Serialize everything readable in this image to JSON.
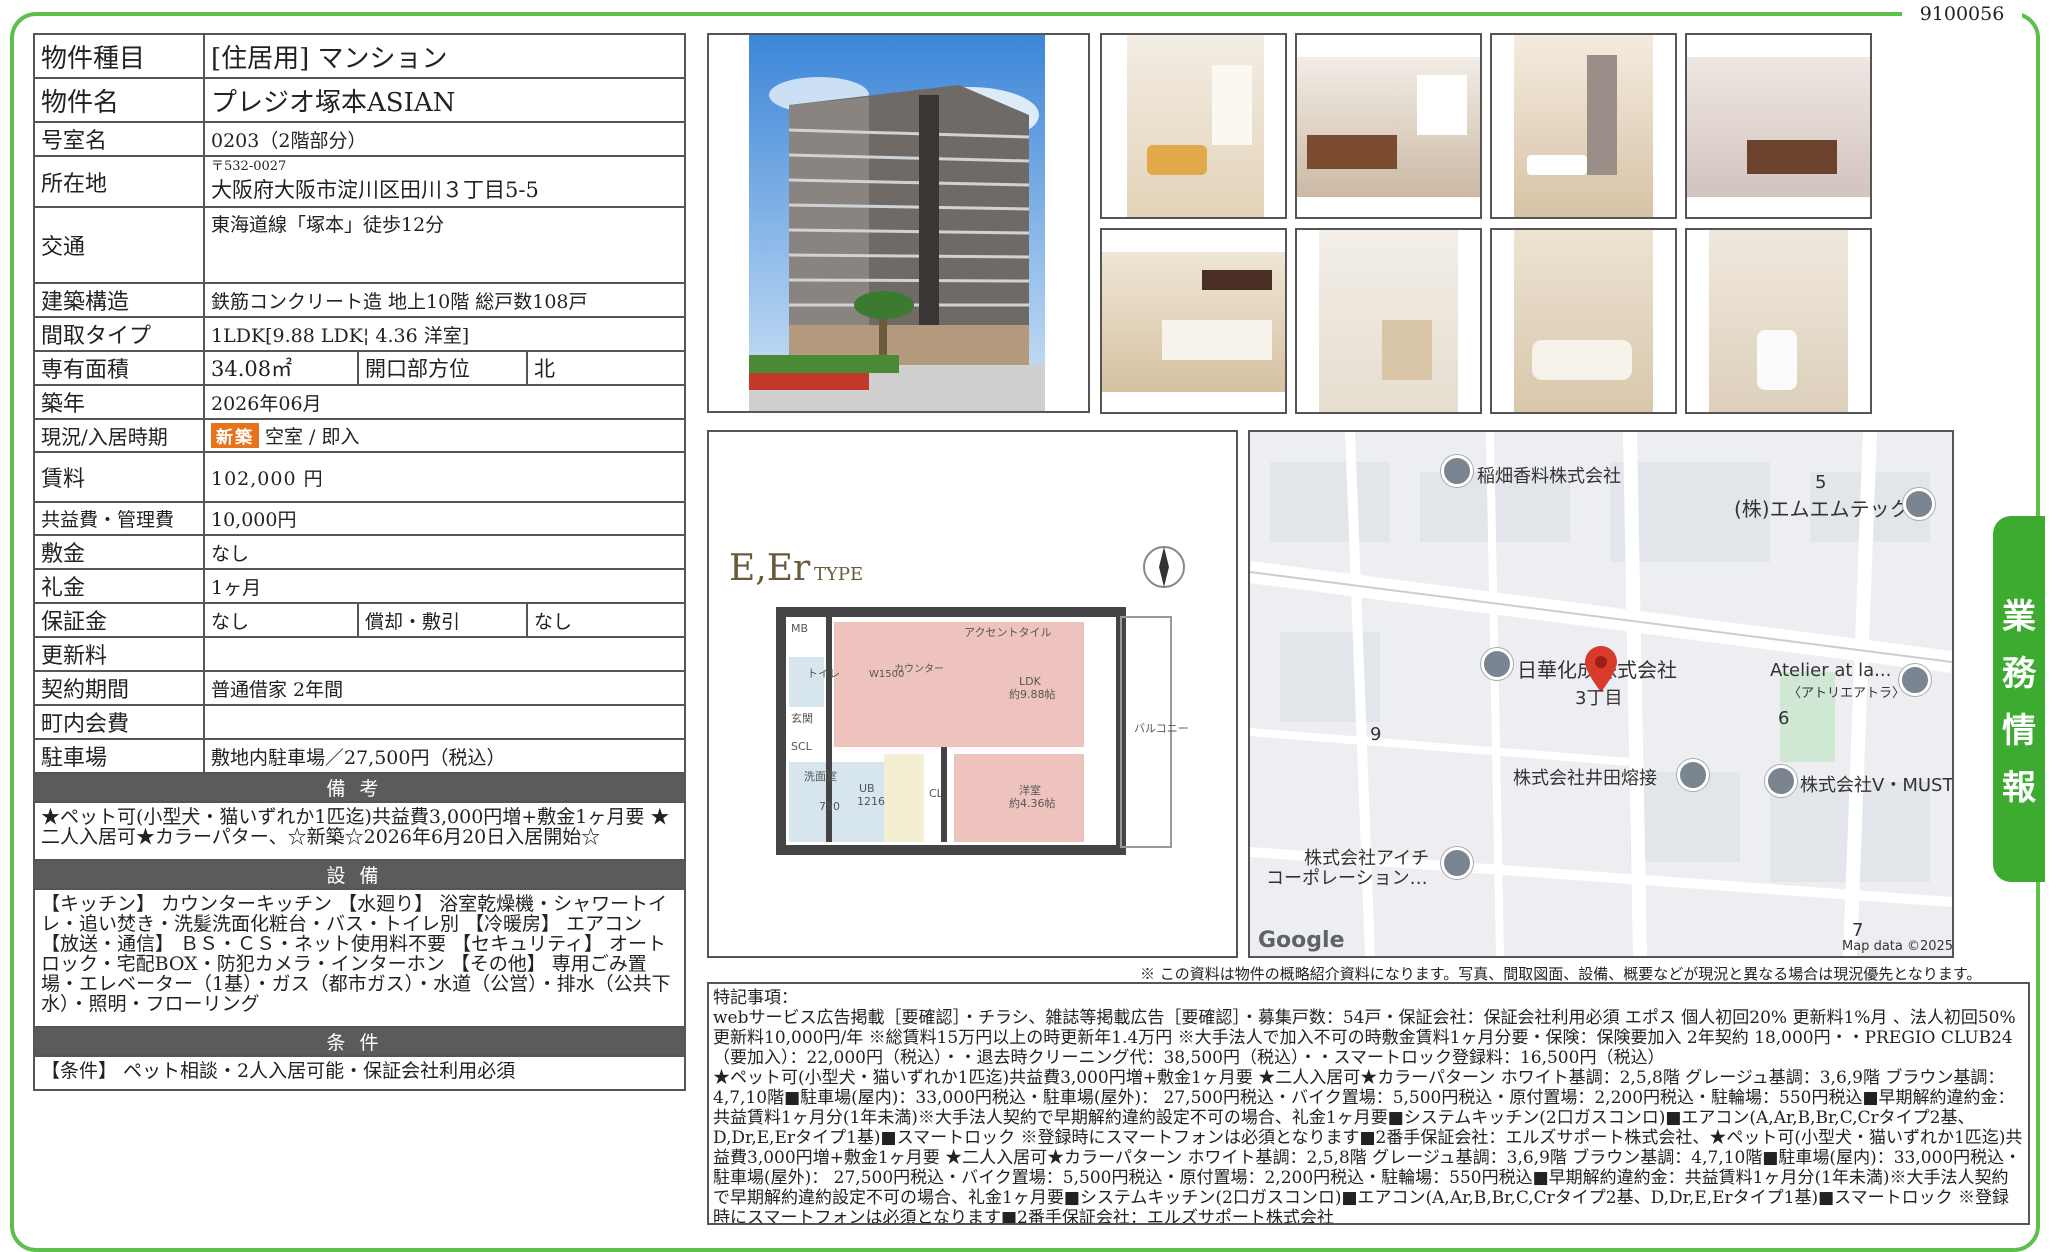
{
  "doc_id": "9100056",
  "side_tab": [
    "業",
    "務",
    "情",
    "報"
  ],
  "property": {
    "type_label": "物件種目",
    "type_value": "[住居用] マンション",
    "name_label": "物件名",
    "name_value": "プレジオ塚本ASIAN",
    "room_label": "号室名",
    "room_value": "0203（2階部分）",
    "address_label": "所在地",
    "zip": "〒532-0027",
    "address": "大阪府大阪市淀川区田川３丁目5-5",
    "access_label": "交通",
    "access_value": "東海道線「塚本」徒歩12分",
    "structure_label": "建築構造",
    "structure_value": "鉄筋コンクリート造 地上10階 総戸数108戸",
    "layout_label": "間取タイプ",
    "layout_value": "1LDK[9.88 LDK¦ 4.36 洋室]",
    "area_label": "専有面積",
    "area_value": "34.08㎡",
    "direction_label": "開口部方位",
    "direction_value": "北",
    "built_label": "築年",
    "built_value": "2026年06月",
    "status_label": "現況/入居時期",
    "status_badge": "新築",
    "status_value": "空室 / 即入",
    "rent_label": "賃料",
    "rent_value": "102,000 円",
    "fee_label": "共益費・管理費",
    "fee_value": "10,000円",
    "deposit_label": "敷金",
    "deposit_value": "なし",
    "keymoney_label": "礼金",
    "keymoney_value": "1ヶ月",
    "guarantee_label": "保証金",
    "guarantee_value": "なし",
    "amort_label": "償却・敷引",
    "amort_value": "なし",
    "renewal_label": "更新料",
    "renewal_value": "",
    "contract_label": "契約期間",
    "contract_value": "普通借家 2年間",
    "community_label": "町内会費",
    "community_value": "",
    "parking_label": "駐車場",
    "parking_value": "敷地内駐車場／27,500円（税込）"
  },
  "remarks": {
    "title": "備考",
    "text": "★ペット可(小型犬・猫いずれか1匹迄)共益費3,000円増+敷金1ヶ月要 ★二人入居可★カラーパター、☆新築☆2026年6月20日入居開始☆"
  },
  "equipment": {
    "title": "設備",
    "text": "【キッチン】 カウンターキッチン 【水廻り】 浴室乾燥機・シャワートイレ・追い焚き・洗髪洗面化粧台・バス・トイレ別 【冷暖房】 エアコン 【放送・通信】 ＢＳ・ＣＳ・ネット使用料不要 【セキュリティ】 オートロック・宅配BOX・防犯カメラ・インターホン 【その他】 専用ごみ置場・エレベーター（1基）・ガス（都市ガス）・水道（公営）・排水（公共下水）・照明・フローリング"
  },
  "conditions": {
    "title": "条件",
    "text": "【条件】 ペット相談・2人入居可能・保証会社利用必須"
  },
  "floorplan": {
    "type_label": "E,Er",
    "type_suffix": "TYPE",
    "rooms": [
      "アクセントタイル",
      "LDK",
      "約9.88帖",
      "洋室",
      "約4.36帖",
      "バルコニー",
      "MB",
      "トイレ",
      "玄関",
      "SCL",
      "洗面室",
      "UB",
      "1216",
      "750",
      "CL",
      "W1500",
      "カウンター"
    ]
  },
  "map": {
    "labels": [
      "稲畑香料株式会社",
      "(株)エムエムテック",
      "日華化成株式会社",
      "3丁目",
      "Atelier at la...",
      "〈アトリエアトラ〉",
      "株式会社井田熔接",
      "株式会社V・MUST",
      "株式会社アイチ",
      "コーポレーション…"
    ],
    "numbers": [
      "5",
      "6",
      "9",
      "7"
    ],
    "google": "Google",
    "credit": "Map data ©2025"
  },
  "disclaimer": "※ この資料は物件の概略紹介資料になります。写真、間取図面、設備、概要などが現況と異なる場合は現況優先となります。",
  "special_notes": {
    "title": "特記事項：",
    "lines": [
      "webサービス広告掲載［要確認］・チラシ、雑誌等掲載広告［要確認］・募集戸数：54戸・保証会社：保証会社利用必須 エポス 個人初回20% 更新料1%月 、法人初回50% 更新料10,000円/年 ※総賃料15万円以上の時更新年1.4万円 ※大手法人で加入不可の時敷金賃料1ヶ月分要・保険：保険要加入 2年契約 18,000円・・PREGIO CLUB24（要加入）：22,000円（税込）・・退去時クリーニング代：38,500円（税込）・・スマートロック登録料：16,500円（税込）",
      "★ペット可(小型犬・猫いずれか1匹迄)共益費3,000円増+敷金1ヶ月要 ★二人入居可★カラーパターン ホワイト基調：2,5,8階 グレージュ基調：3,6,9階 ブラウン基調：4,7,10階■駐車場(屋内)：33,000円税込・駐車場(屋外)： 27,500円税込・バイク置場：5,500円税込・原付置場：2,200円税込・駐輪場：550円税込■早期解約違約金：共益賃料1ヶ月分(1年未満)※大手法人契約で早期解約違約設定不可の場合、礼金1ヶ月要■システムキッチン(2口ガスコンロ)■エアコン(A,Ar,B,Br,C,Crタイプ2基、D,Dr,E,Erタイプ1基)■スマートロック ※登録時にスマートフォンは必須となります■2番手保証会社：エルズサポート株式会社、★ペット可(小型犬・猫いずれか1匹迄)共益費3,000円増+敷金1ヶ月要 ★二人入居可★カラーパターン ホワイト基調：2,5,8階 グレージュ基調：3,6,9階 ブラウン基調：4,7,10階■駐車場(屋内)：33,000円税込・駐車場(屋外)： 27,500円税込・バイク置場：5,500円税込・原付置場：2,200円税込・駐輪場：550円税込■早期解約違約金：共益賃料1ヶ月分(1年未満)※大手法人契約で早期解約違約設定不可の場合、礼金1ヶ月要■システムキッチン(2口ガスコンロ)■エアコン(A,Ar,B,Br,C,Crタイプ2基、D,Dr,E,Erタイプ1基)■スマートロック ※登録時にスマートフォンは必須となります■2番手保証会社：エルズサポート株式会社"
    ]
  },
  "colors": {
    "frame_green": "#5cc04a",
    "tab_green": "#3dab2f",
    "section_gray": "#5b5b5b",
    "badge_orange": "#e8731f",
    "map_pin_red": "#d93a2b"
  }
}
